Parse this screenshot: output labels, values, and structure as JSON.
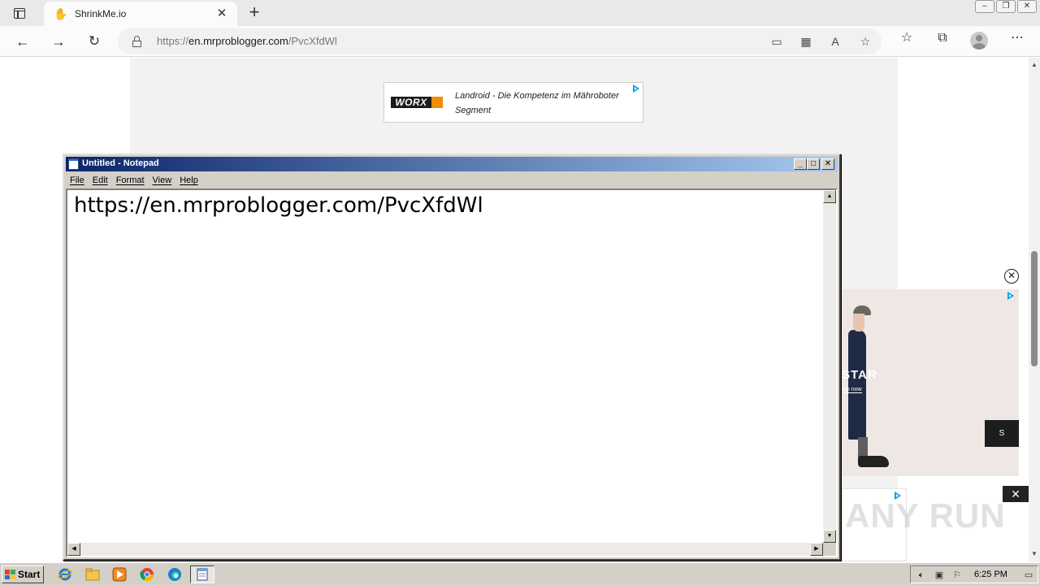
{
  "browser": {
    "tab": {
      "title": "ShrinkMe.io",
      "favicon": "shrinkme-hand-icon"
    },
    "url": {
      "scheme": "https://",
      "host": "en.mrproblogger.com",
      "path": "/PvcXfdWl"
    }
  },
  "page": {
    "top_ad": {
      "brand": "WORX",
      "text": "Landroid - Die Kompetenz im Mähroboter Segment",
      "brand_color": "#f28c00"
    },
    "side_ad": {
      "brand_partial": "STAR",
      "cta_partial": "op now",
      "button_partial": "S"
    }
  },
  "watermark": "ANY RUN",
  "notepad": {
    "title": "Untitled - Notepad",
    "menus": [
      "File",
      "Edit",
      "Format",
      "View",
      "Help"
    ],
    "content": "https://en.mrproblogger.com/PvcXfdWl"
  },
  "taskbar": {
    "start_label": "Start",
    "clock": "6:25 PM",
    "apps": [
      "ie-icon",
      "explorer-folder-icon",
      "media-player-icon",
      "chrome-icon",
      "edge-icon",
      "notepad-icon"
    ]
  },
  "colors": {
    "notepad_titlebar_start": "#0a246a",
    "notepad_titlebar_end": "#a6caf0",
    "adchoices": "#00a0e4"
  }
}
